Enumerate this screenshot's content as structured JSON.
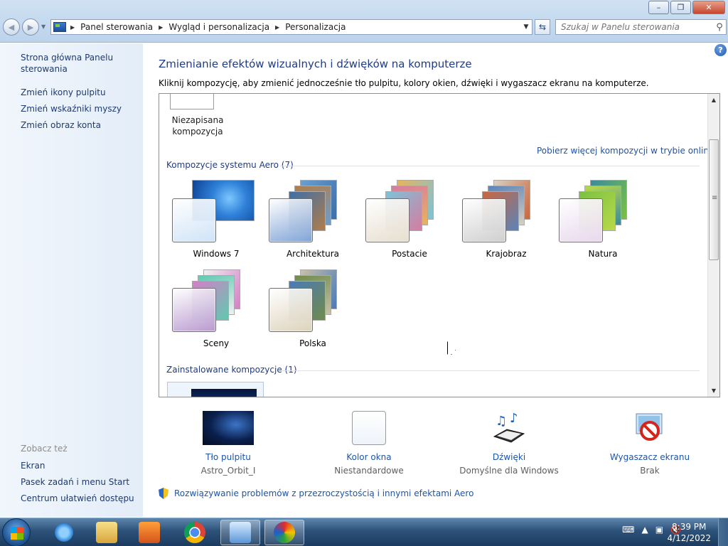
{
  "window": {
    "controls": {
      "minimize": "–",
      "maximize": "❐",
      "close": "✕"
    }
  },
  "nav": {
    "breadcrumbs": [
      "Panel sterowania",
      "Wygląd i personalizacja",
      "Personalizacja"
    ],
    "search_placeholder": "Szukaj w Panelu sterowania"
  },
  "sidebar": {
    "links": [
      "Strona główna Panelu sterowania",
      "Zmień ikony pulpitu",
      "Zmień wskaźniki myszy",
      "Zmień obraz konta"
    ],
    "see_also_title": "Zobacz też",
    "see_also": [
      "Ekran",
      "Pasek zadań i menu Start",
      "Centrum ułatwień dostępu"
    ]
  },
  "main": {
    "heading": "Zmienianie efektów wizualnych i dźwięków na komputerze",
    "description": "Kliknij kompozycję, aby zmienić jednocześnie tło pulpitu, kolory okien, dźwięki i wygaszacz ekranu na komputerze.",
    "unsaved_theme": "Niezapisana kompozycja",
    "online_link": "Pobierz więcej kompozycji w trybie online",
    "aero_group": "Kompozycje systemu Aero (7)",
    "installed_group": "Zainstalowane kompozycje (1)",
    "themes": [
      {
        "name": "Windows 7",
        "colors": [
          "#1f5fb0",
          "#2f80d8",
          "#0a3d8f"
        ],
        "glass": "#cfe3f7"
      },
      {
        "name": "Architektura",
        "colors": [
          "#3d6fa8",
          "#b07d4a",
          "#6a9fd0"
        ],
        "glass": "#7fa3d6"
      },
      {
        "name": "Postacie",
        "colors": [
          "#7cc3d8",
          "#d67ca0",
          "#e8b35c"
        ],
        "glass": "#e6dfcf"
      },
      {
        "name": "Krajobraz",
        "colors": [
          "#c9663e",
          "#5c84b8",
          "#d8d0c2"
        ],
        "glass": "#cfcfcf"
      },
      {
        "name": "Natura",
        "colors": [
          "#7ac143",
          "#b9d94a",
          "#3b8a9c"
        ],
        "glass": "#e8d8ec"
      },
      {
        "name": "Sceny",
        "colors": [
          "#d47fc7",
          "#5fc9b0",
          "#f0f0f0"
        ],
        "glass": "#b999cf"
      },
      {
        "name": "Polska",
        "colors": [
          "#4a7ab8",
          "#6f8b4c",
          "#c9c0a8"
        ],
        "glass": "#ddd3bd"
      }
    ]
  },
  "bottom": {
    "wallpaper": {
      "label": "Tło pulpitu",
      "value": "Astro_Orbit_I"
    },
    "window_color": {
      "label": "Kolor okna",
      "value": "Niestandardowe"
    },
    "sounds": {
      "label": "Dźwięki",
      "value": "Domyślne dla Windows"
    },
    "screensaver": {
      "label": "Wygaszacz ekranu",
      "value": "Brak"
    },
    "troubleshoot": "Rozwiązywanie problemów z przezroczystością i innymi efektami Aero"
  },
  "taskbar": {
    "time": "8:39 PM",
    "date": "4/12/2022"
  }
}
